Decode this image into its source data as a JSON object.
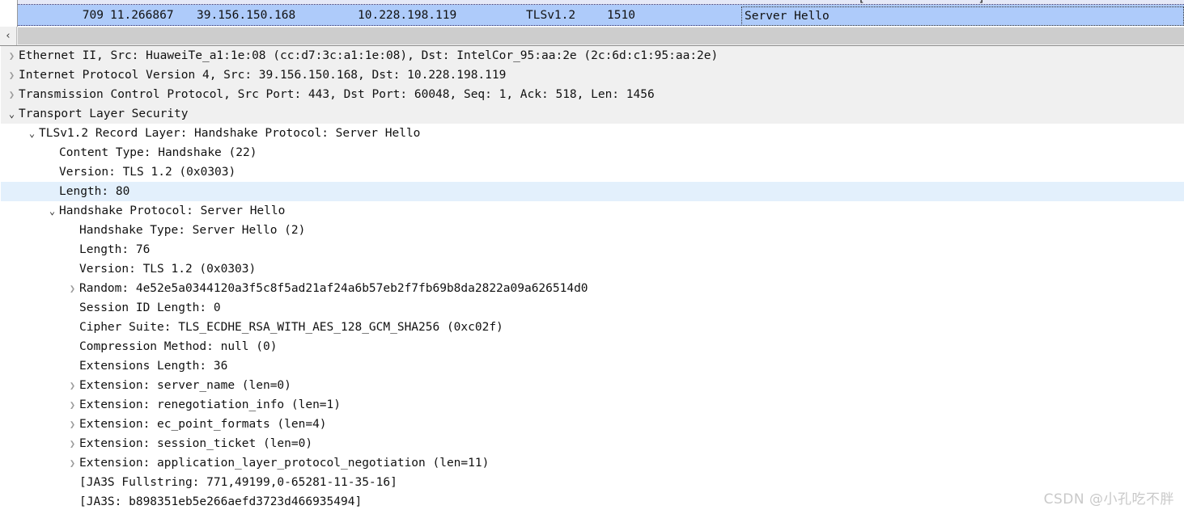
{
  "packet_list": {
    "clipped_row_tail": "[                ]",
    "selected_packet": {
      "no": "709",
      "time": "11.266867",
      "source": "39.156.150.168",
      "destination": "10.228.198.119",
      "protocol": "TLSv1.2",
      "length": "1510",
      "info": "Server Hello"
    },
    "selection_color": "#aecbfa"
  },
  "scrollbar": {
    "left_arrow_glyph": "‹"
  },
  "detail_tree": {
    "highlight_color": "#e3f0fc",
    "shade_color": "#f0f0f0",
    "rows": [
      {
        "indent": 0,
        "arrow": "collapsed",
        "shaded": true,
        "highlight": false,
        "label": "Ethernet II, Src: HuaweiTe_a1:1e:08 (cc:d7:3c:a1:1e:08), Dst: IntelCor_95:aa:2e (2c:6d:c1:95:aa:2e)"
      },
      {
        "indent": 0,
        "arrow": "collapsed",
        "shaded": true,
        "highlight": false,
        "label": "Internet Protocol Version 4, Src: 39.156.150.168, Dst: 10.228.198.119"
      },
      {
        "indent": 0,
        "arrow": "collapsed",
        "shaded": true,
        "highlight": false,
        "label": "Transmission Control Protocol, Src Port: 443, Dst Port: 60048, Seq: 1, Ack: 518, Len: 1456"
      },
      {
        "indent": 0,
        "arrow": "expanded",
        "shaded": true,
        "highlight": false,
        "label": "Transport Layer Security"
      },
      {
        "indent": 1,
        "arrow": "expanded",
        "shaded": false,
        "highlight": false,
        "label": "TLSv1.2 Record Layer: Handshake Protocol: Server Hello"
      },
      {
        "indent": 2,
        "arrow": "blank",
        "shaded": false,
        "highlight": false,
        "label": "Content Type: Handshake (22)"
      },
      {
        "indent": 2,
        "arrow": "blank",
        "shaded": false,
        "highlight": false,
        "label": "Version: TLS 1.2 (0x0303)"
      },
      {
        "indent": 2,
        "arrow": "blank",
        "shaded": false,
        "highlight": true,
        "label": "Length: 80"
      },
      {
        "indent": 2,
        "arrow": "expanded",
        "shaded": false,
        "highlight": false,
        "label": "Handshake Protocol: Server Hello"
      },
      {
        "indent": 3,
        "arrow": "blank",
        "shaded": false,
        "highlight": false,
        "label": "Handshake Type: Server Hello (2)"
      },
      {
        "indent": 3,
        "arrow": "blank",
        "shaded": false,
        "highlight": false,
        "label": "Length: 76"
      },
      {
        "indent": 3,
        "arrow": "blank",
        "shaded": false,
        "highlight": false,
        "label": "Version: TLS 1.2 (0x0303)"
      },
      {
        "indent": 3,
        "arrow": "collapsed",
        "shaded": false,
        "highlight": false,
        "label": "Random: 4e52e5a0344120a3f5c8f5ad21af24a6b57eb2f7fb69b8da2822a09a626514d0"
      },
      {
        "indent": 3,
        "arrow": "blank",
        "shaded": false,
        "highlight": false,
        "label": "Session ID Length: 0"
      },
      {
        "indent": 3,
        "arrow": "blank",
        "shaded": false,
        "highlight": false,
        "label": "Cipher Suite: TLS_ECDHE_RSA_WITH_AES_128_GCM_SHA256 (0xc02f)"
      },
      {
        "indent": 3,
        "arrow": "blank",
        "shaded": false,
        "highlight": false,
        "label": "Compression Method: null (0)"
      },
      {
        "indent": 3,
        "arrow": "blank",
        "shaded": false,
        "highlight": false,
        "label": "Extensions Length: 36"
      },
      {
        "indent": 3,
        "arrow": "collapsed",
        "shaded": false,
        "highlight": false,
        "label": "Extension: server_name (len=0)"
      },
      {
        "indent": 3,
        "arrow": "collapsed",
        "shaded": false,
        "highlight": false,
        "label": "Extension: renegotiation_info (len=1)"
      },
      {
        "indent": 3,
        "arrow": "collapsed",
        "shaded": false,
        "highlight": false,
        "label": "Extension: ec_point_formats (len=4)"
      },
      {
        "indent": 3,
        "arrow": "collapsed",
        "shaded": false,
        "highlight": false,
        "label": "Extension: session_ticket (len=0)"
      },
      {
        "indent": 3,
        "arrow": "collapsed",
        "shaded": false,
        "highlight": false,
        "label": "Extension: application_layer_protocol_negotiation (len=11)"
      },
      {
        "indent": 3,
        "arrow": "blank",
        "shaded": false,
        "highlight": false,
        "label": "[JA3S Fullstring: 771,49199,0-65281-11-35-16]"
      },
      {
        "indent": 3,
        "arrow": "blank",
        "shaded": false,
        "highlight": false,
        "label": "[JA3S: b898351eb5e266aefd3723d466935494]"
      }
    ]
  },
  "watermark": {
    "text": "CSDN @小孔吃不胖"
  }
}
